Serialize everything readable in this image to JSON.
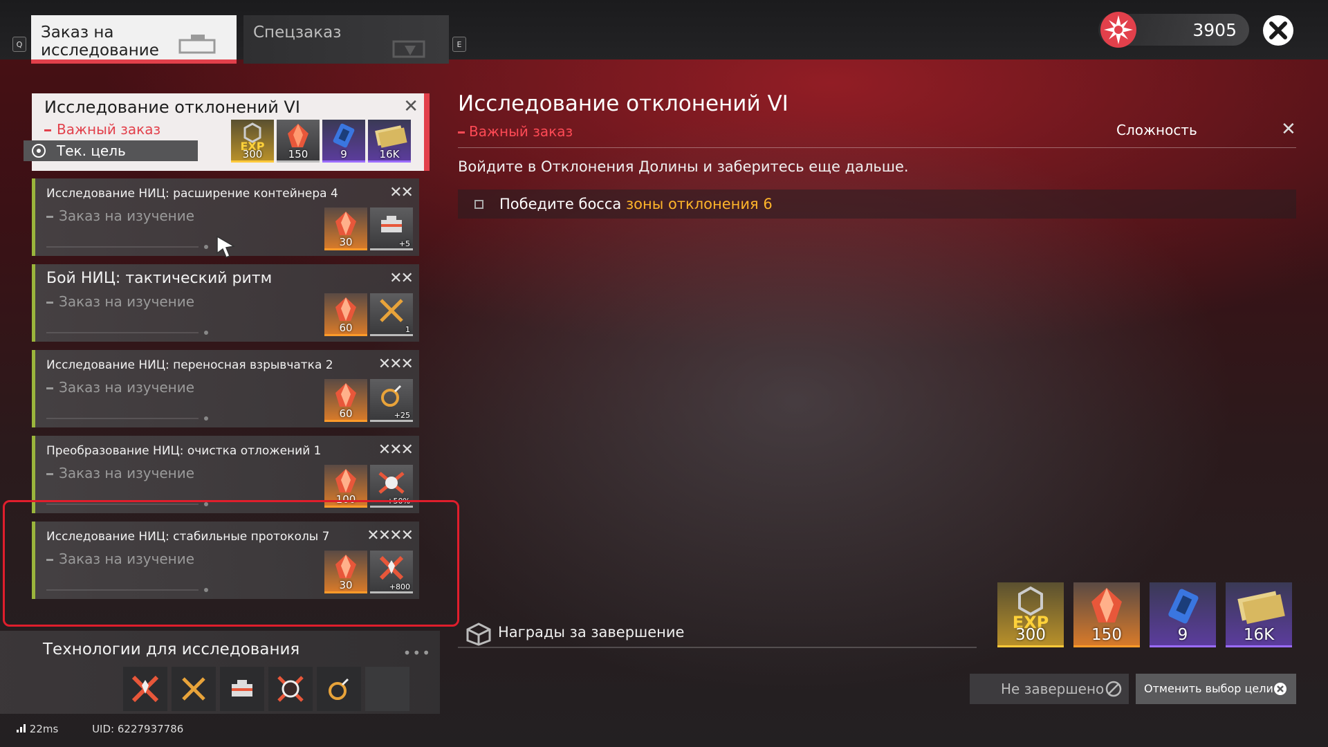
{
  "tabs": {
    "key_left": "Q",
    "key_right": "E",
    "items": [
      {
        "label": "Заказ на исследование",
        "active": true
      },
      {
        "label": "Спецзаказ",
        "active": false
      }
    ]
  },
  "currency": {
    "icon": "gear-flower-icon",
    "value": "3905"
  },
  "quest_list": {
    "current": {
      "title": "Исследование отклонений VI",
      "type": "Важный заказ",
      "current_goal": "Тек. цель",
      "rewards": [
        {
          "icon": "exp-icon",
          "qty": "300",
          "style": "gold"
        },
        {
          "icon": "crystal-icon",
          "qty": "150",
          "style": "gray"
        },
        {
          "icon": "blue-module-icon",
          "qty": "9",
          "style": "purple"
        },
        {
          "icon": "money-icon",
          "qty": "16K",
          "style": "purple"
        }
      ]
    },
    "items": [
      {
        "title": "Исследование НИЦ: расширение контейнера 4",
        "type": "Заказ на изучение",
        "stars": "✕✕",
        "rewards": [
          {
            "icon": "crystal-icon",
            "qty": "30"
          },
          {
            "icon": "container-icon",
            "qty": "+5"
          }
        ]
      },
      {
        "title": "Бой НИЦ: тактический ритм",
        "type": "Заказ на изучение",
        "stars": "✕✕",
        "rewards": [
          {
            "icon": "crystal-icon",
            "qty": "60"
          },
          {
            "icon": "swords-icon",
            "qty": "1"
          }
        ]
      },
      {
        "title": "Исследование НИЦ: переносная взрывчатка 2",
        "type": "Заказ на изучение",
        "stars": "✕✕✕",
        "rewards": [
          {
            "icon": "crystal-icon",
            "qty": "60"
          },
          {
            "icon": "bomb-icon",
            "qty": "+25"
          }
        ]
      },
      {
        "title": "Преобразование НИЦ: очистка отложений 1",
        "type": "Заказ на изучение",
        "stars": "✕✕✕",
        "rewards": [
          {
            "icon": "crystal-icon",
            "qty": "100"
          },
          {
            "icon": "purify-icon",
            "qty": "+50%"
          }
        ]
      },
      {
        "title": "Исследование НИЦ: стабильные протоколы 7",
        "type": "Заказ на изучение",
        "stars": "✕✕✕✕",
        "rewards": [
          {
            "icon": "crystal-icon",
            "qty": "30"
          },
          {
            "icon": "protocol-icon",
            "qty": "+800"
          }
        ]
      }
    ]
  },
  "tech": {
    "title": "Технологии для исследования",
    "more": "•••",
    "icons": [
      "protocol-icon",
      "swords-icon",
      "container-icon",
      "purify-icon",
      "bomb-icon",
      "empty-slot"
    ]
  },
  "status": {
    "ping": "22ms",
    "uid": "UID: 6227937786"
  },
  "detail": {
    "title": "Исследование отклонений VI",
    "type": "Важный заказ",
    "difficulty_label": "Сложность",
    "description": "Войдите в Отклонения Долины и заберитесь еще дальше.",
    "objective_prefix": "Победите босса",
    "objective_highlight": "зоны отклонения 6",
    "rewards_label": "Награды за завершение",
    "rewards": [
      {
        "icon": "exp-icon",
        "qty": "300"
      },
      {
        "icon": "crystal-icon",
        "qty": "150"
      },
      {
        "icon": "blue-module-icon",
        "qty": "9"
      },
      {
        "icon": "money-icon",
        "qty": "16K"
      }
    ],
    "incomplete_label": "Не завершено",
    "cancel_label": "Отменить выбор цели"
  },
  "colors": {
    "accent_red": "#e2404b",
    "highlight_orange": "#ffb52a",
    "list_green": "#9ab53c"
  }
}
